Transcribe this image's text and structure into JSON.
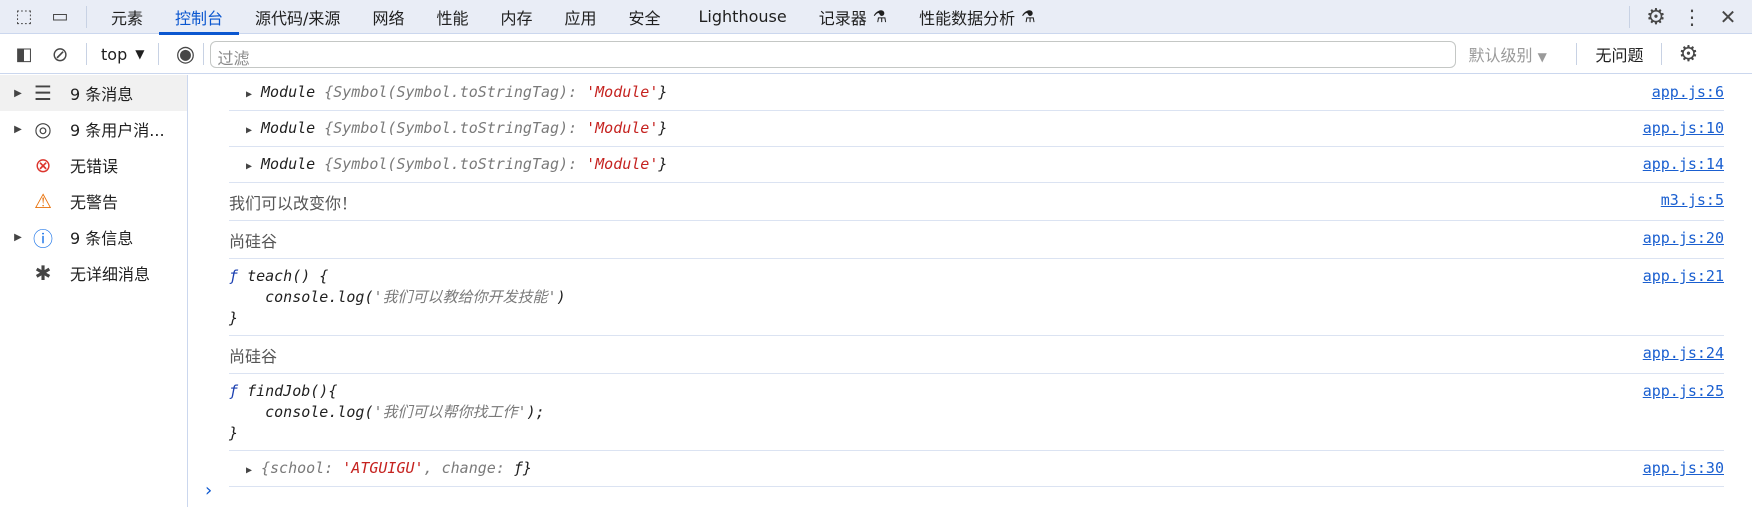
{
  "tabs": [
    "元素",
    "控制台",
    "源代码/来源",
    "网络",
    "性能",
    "内存",
    "应用",
    "安全",
    "Lighthouse",
    "记录器",
    "性能数据分析"
  ],
  "active_tab": "控制台",
  "toolbar": {
    "context": "top",
    "filter_placeholder": "过滤",
    "level": "默认级别",
    "issues": "无问题"
  },
  "sidebar": [
    {
      "label": "9 条消息",
      "icon": "list-icon",
      "expand": true
    },
    {
      "label": "9 条用户消...",
      "icon": "user-icon",
      "expand": true
    },
    {
      "label": "无错误",
      "icon": "error-icon",
      "expand": false
    },
    {
      "label": "无警告",
      "icon": "warning-icon",
      "expand": false
    },
    {
      "label": "9 条信息",
      "icon": "info-icon",
      "expand": true
    },
    {
      "label": "无详细消息",
      "icon": "bug-icon",
      "expand": false
    }
  ],
  "colors": {
    "accent": "#0b57d0",
    "string": "#c5221f",
    "error": "#dc362e",
    "warning": "#e8710a",
    "info": "#1a73e8"
  },
  "messages": [
    {
      "type": "module",
      "name": "Module",
      "key": "Symbol(Symbol.toStringTag)",
      "value": "'Module'",
      "source": "app.js:6"
    },
    {
      "type": "module",
      "name": "Module",
      "key": "Symbol(Symbol.toStringTag)",
      "value": "'Module'",
      "source": "app.js:10"
    },
    {
      "type": "module",
      "name": "Module",
      "key": "Symbol(Symbol.toStringTag)",
      "value": "'Module'",
      "source": "app.js:14"
    },
    {
      "type": "text",
      "text": "我们可以改变你！",
      "source": "m3.js:5"
    },
    {
      "type": "text",
      "text": "尚硅谷",
      "source": "app.js:20"
    },
    {
      "type": "function",
      "line1": "teach() {",
      "line2": "console.log(",
      "str": "'我们可以教给你开发技能'",
      "line2end": ")",
      "line3": "}",
      "source": "app.js:21"
    },
    {
      "type": "text",
      "text": "尚硅谷",
      "source": "app.js:24"
    },
    {
      "type": "function",
      "line1": "findJob(){",
      "line2": "console.log(",
      "str": "'我们可以帮你找工作'",
      "line2end": ");",
      "line3": "}",
      "source": "app.js:25"
    },
    {
      "type": "object",
      "k1": "school",
      "v1": "'ATGUIGU'",
      "k2": "change",
      "v2": "ƒ",
      "source": "app.js:30"
    }
  ]
}
